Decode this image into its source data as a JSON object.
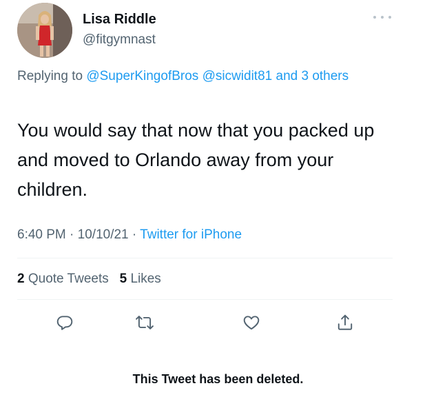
{
  "author": {
    "display_name": "Lisa Riddle",
    "handle": "@fitgymnast",
    "avatar_icon": "profile-photo"
  },
  "more_icon": "more-horizontal-icon",
  "reply": {
    "prefix": "Replying to",
    "user1": "@SuperKingofBros",
    "user2": "@sicwidit81",
    "others": "and 3 others"
  },
  "tweet": {
    "text": "You would say that now that you packed up and moved to Orlando away from your children."
  },
  "meta": {
    "time": "6:40 PM",
    "sep1": "·",
    "date": "10/10/21",
    "sep2": "·",
    "source": "Twitter for iPhone"
  },
  "stats": {
    "quote_count": "2",
    "quote_label": "Quote Tweets",
    "like_count": "5",
    "like_label": "Likes"
  },
  "actions": [
    {
      "icon": "reply-icon"
    },
    {
      "icon": "retweet-icon"
    },
    {
      "icon": "like-icon"
    },
    {
      "icon": "share-icon"
    }
  ],
  "footer": {
    "deleted_text": "This Tweet has been deleted."
  },
  "colors": {
    "text": "#0f1419",
    "secondary": "#536471",
    "link": "#1d9bf0",
    "divider": "#eff3f4",
    "icon": "#536471"
  }
}
